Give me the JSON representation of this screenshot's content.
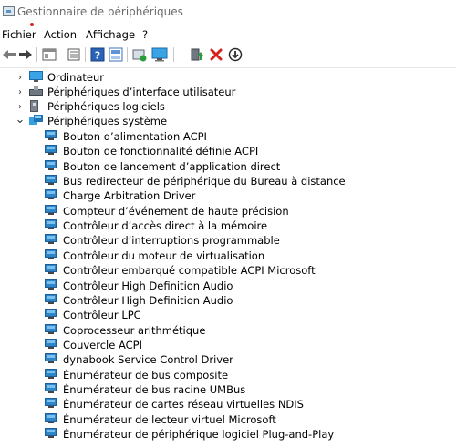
{
  "window": {
    "title": "Gestionnaire de périphériques"
  },
  "menu": [
    "Fichier",
    "Action",
    "Affichage",
    "?"
  ],
  "toolbar": {
    "buttons": [
      "back-icon",
      "forward-icon",
      "show-hide-tree-icon",
      "properties-icon",
      "help-icon",
      "view-icon",
      "update-driver-icon",
      "scan-hardware-icon",
      "enable-device-icon",
      "uninstall-device-icon",
      "disable-device-icon"
    ]
  },
  "colors": {
    "uninstall": "#d6201b",
    "green": "#2c9b3a",
    "blue": "#2f86c7"
  },
  "tree": {
    "categories": [
      {
        "label": "Ordinateur",
        "expander": "›"
      },
      {
        "label": "Périphériques d’interface utilisateur",
        "expander": "›"
      },
      {
        "label": "Périphériques logiciels",
        "expander": "›"
      },
      {
        "label": "Périphériques système",
        "expander": "⌄"
      }
    ],
    "system_devices": [
      "Bouton d’alimentation ACPI",
      "Bouton de fonctionnalité définie ACPI",
      "Bouton de lancement d’application direct",
      "Bus redirecteur de périphérique du Bureau à distance",
      "Charge Arbitration Driver",
      "Compteur d’événement de haute précision",
      "Contrôleur d’accès direct à la mémoire",
      "Contrôleur d’interruptions programmable",
      "Contrôleur du moteur de virtualisation",
      "Contrôleur embarqué compatible ACPI Microsoft",
      "Contrôleur High Definition Audio",
      "Contrôleur High Definition Audio",
      "Contrôleur LPC",
      "Coprocesseur arithmétique",
      "Couvercle ACPI",
      "dynabook Service Control Driver",
      "Énumérateur de bus composite",
      "Énumérateur de bus racine UMBus",
      "Énumérateur de cartes réseau virtuelles NDIS",
      "Énumérateur de lecteur virtuel Microsoft",
      "Énumérateur de périphérique logiciel Plug-and-Play"
    ]
  }
}
